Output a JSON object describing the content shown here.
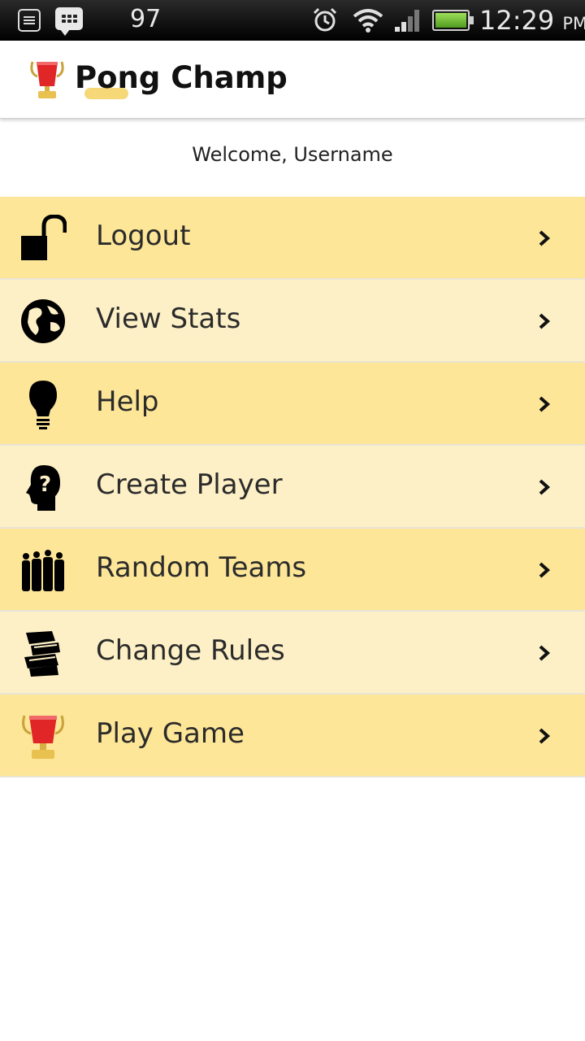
{
  "status_bar": {
    "notification_count": "97",
    "time": "12:29",
    "ampm": "PM",
    "icons": [
      "notification-list-icon",
      "bbm-icon",
      "alarm-icon",
      "wifi-icon",
      "signal-icon",
      "battery-icon"
    ],
    "battery_color": "#5cb02a"
  },
  "header": {
    "title": "Pong Champ"
  },
  "welcome_text": "Welcome, Username",
  "menu": {
    "items": [
      {
        "label": "Logout",
        "icon": "unlocked-padlock-icon"
      },
      {
        "label": "View Stats",
        "icon": "globe-icon"
      },
      {
        "label": "Help",
        "icon": "lightbulb-icon"
      },
      {
        "label": "Create Player",
        "icon": "question-head-icon"
      },
      {
        "label": "Random Teams",
        "icon": "people-group-icon"
      },
      {
        "label": "Change Rules",
        "icon": "books-icon"
      },
      {
        "label": "Play Game",
        "icon": "trophy-cup-icon"
      }
    ]
  },
  "colors": {
    "row_dark": "#fde697",
    "row_light": "#fdf0c6",
    "text": "#2b2b2b",
    "status_bar": "#000000"
  }
}
